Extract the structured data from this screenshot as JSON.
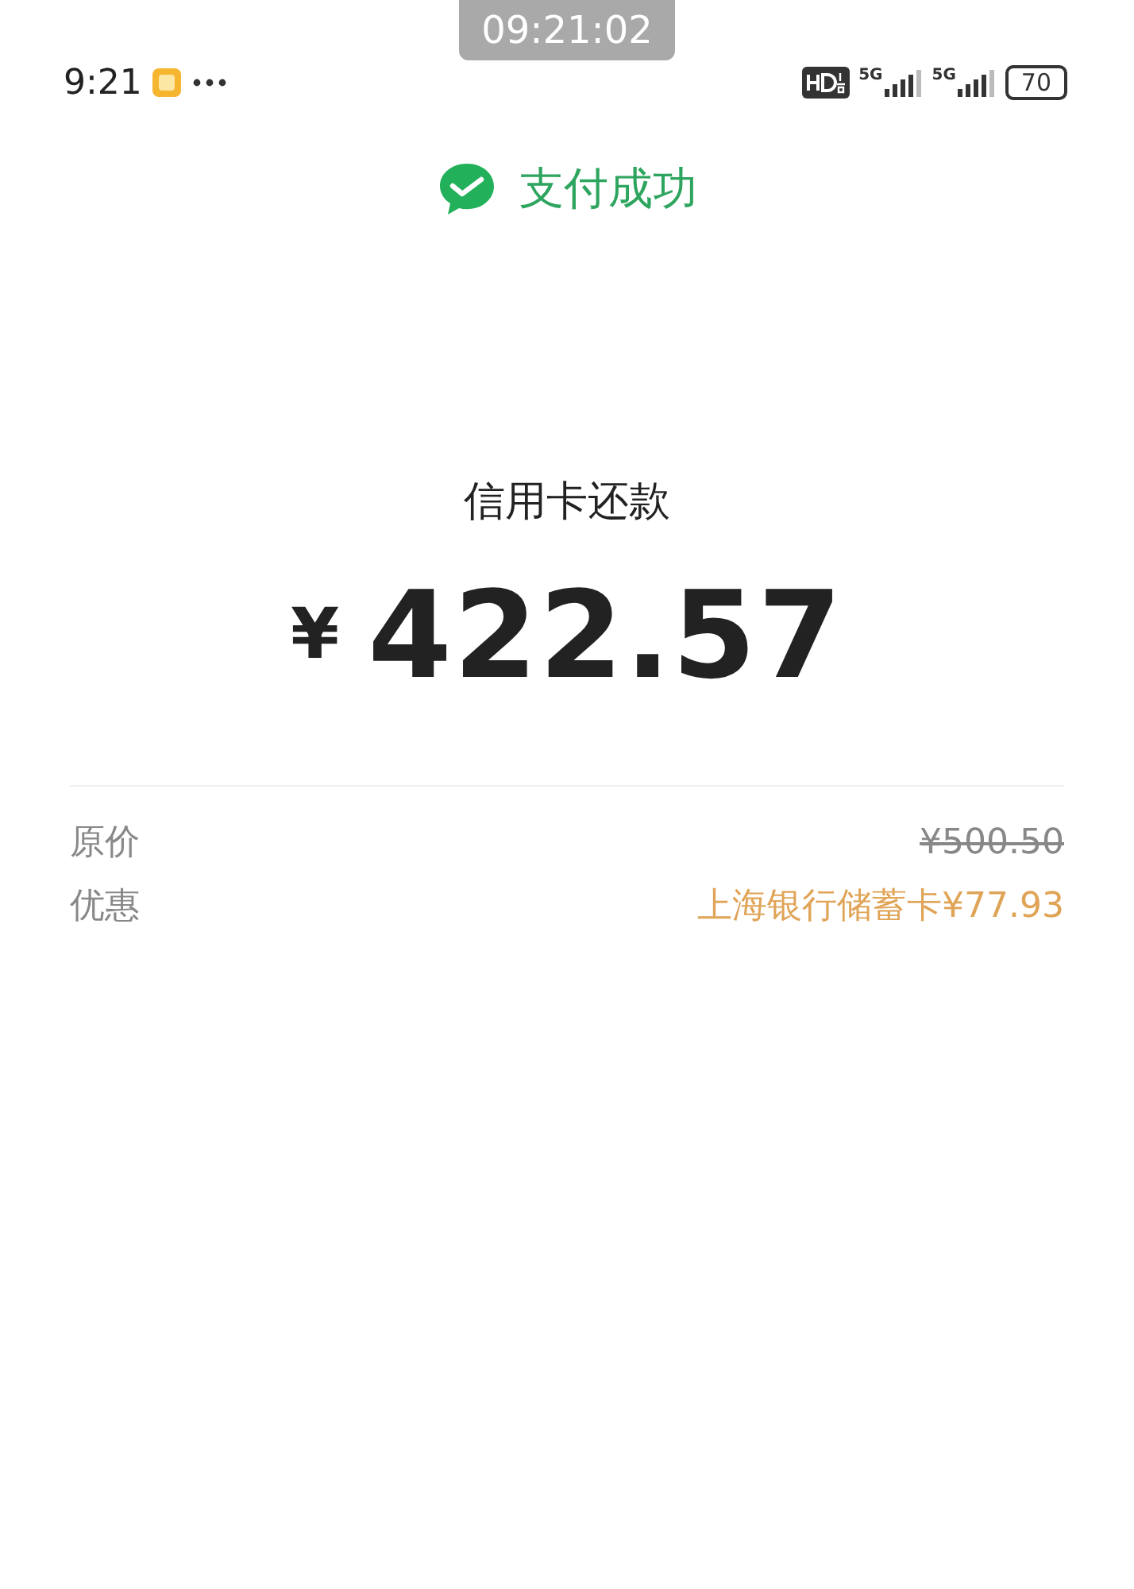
{
  "recording_timer": "09:21:02",
  "status_bar": {
    "time": "9:21",
    "networks": [
      "5G",
      "5G"
    ],
    "battery": "70"
  },
  "result": {
    "status": "支付成功"
  },
  "payment": {
    "title": "信用卡还款",
    "currency": "¥",
    "amount": "422.57"
  },
  "details": [
    {
      "label": "原价",
      "value": "¥500.50",
      "kind": "strike"
    },
    {
      "label": "优惠",
      "value": "上海银行储蓄卡¥77.93",
      "kind": "discount"
    }
  ]
}
